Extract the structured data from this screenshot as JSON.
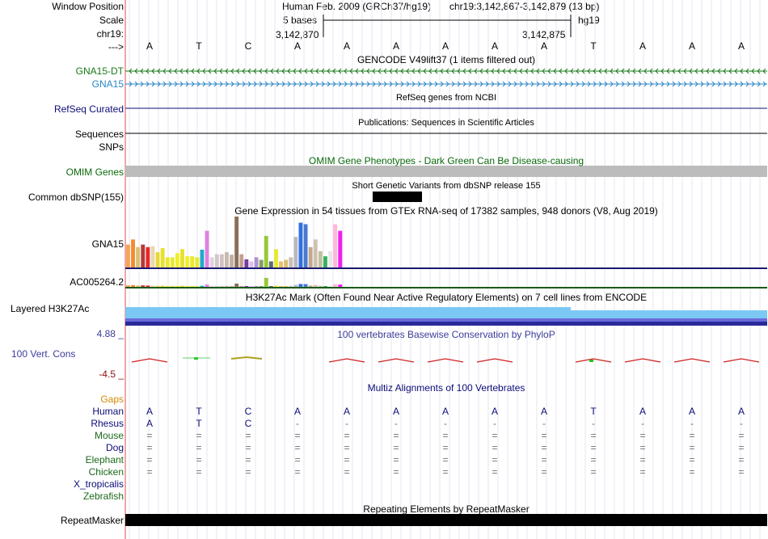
{
  "header": {
    "window_position_label": "Window Position",
    "scale_label": "Scale",
    "chr_label": "chr19:",
    "arrow_label": "--->",
    "assembly_text": "Human Feb. 2009 (GRCh37/hg19)",
    "position_text": "chr19:3,142,867-3,142,879 (13 bp)",
    "scale_text": "5 bases",
    "hg_label": "hg19",
    "coord_left": "3,142,870",
    "coord_right": "3,142,875"
  },
  "bases": [
    "A",
    "T",
    "C",
    "A",
    "A",
    "A",
    "A",
    "A",
    "A",
    "T",
    "A",
    "A",
    "A"
  ],
  "tracks": {
    "gencode": {
      "title": "GENCODE V49lift37 (1 items filtered out)",
      "item1": "GNA15-DT",
      "item2": "GNA15",
      "color1": "#1a7a1a",
      "color2": "#2a86c6"
    },
    "refseq": {
      "label": "RefSeq Curated",
      "title": "RefSeq genes from NCBI",
      "color": "#0c0c78"
    },
    "sequences": {
      "label": "Sequences",
      "title": "Publications: Sequences in Scientific Articles"
    },
    "snps": {
      "label": "SNPs"
    },
    "omim": {
      "label": "OMIM Genes",
      "title": "OMIM Gene Phenotypes - Dark Green Can Be Disease-causing",
      "color": "#0a6a0a"
    },
    "dbsnp": {
      "label": "Common dbSNP(155)",
      "title": "Short Genetic Variants from dbSNP release 155"
    },
    "gtex": {
      "title": "Gene Expression in 54 tissues from GTEx RNA-seq of 17382 samples, 948 donors (V8, Aug 2019)",
      "gene1": "GNA15",
      "gene2": "AC005264.2"
    },
    "h3k27ac": {
      "label": "Layered H3K27Ac",
      "title": "H3K27Ac Mark (Often Found Near Active Regulatory Elements) on 7 cell lines from ENCODE"
    },
    "cons": {
      "label": "100 Vert. Cons",
      "max": "4.88 _",
      "min": "-4.5 _",
      "title": "100 vertebrates Basewise Conservation by PhyloP",
      "color": "#3c3c9c"
    },
    "multiz": {
      "title": "Multiz Alignments of 100 Vertebrates",
      "gaps_label": "Gaps",
      "gaps_color": "#d08a00",
      "color": "#0c0c78"
    },
    "repeatmasker": {
      "label": "RepeatMasker",
      "title": "Repeating Elements by RepeatMasker"
    }
  },
  "species": [
    {
      "name": "Human",
      "color": "#0c0c78",
      "row": [
        "A",
        "T",
        "C",
        "A",
        "A",
        "A",
        "A",
        "A",
        "A",
        "T",
        "A",
        "A",
        "A"
      ]
    },
    {
      "name": "Rhesus",
      "color": "#0c0c78",
      "row": [
        "A",
        "T",
        "C",
        "-",
        "-",
        "-",
        "-",
        "-",
        "-",
        "-",
        "-",
        "-",
        "-"
      ]
    },
    {
      "name": "Mouse",
      "color": "#1a6a1a",
      "row": [
        "=",
        "=",
        "=",
        "=",
        "=",
        "=",
        "=",
        "=",
        "=",
        "=",
        "=",
        "=",
        "="
      ]
    },
    {
      "name": "Dog",
      "color": "#0c0c78",
      "row": [
        "=",
        "=",
        "=",
        "=",
        "=",
        "=",
        "=",
        "=",
        "=",
        "=",
        "=",
        "=",
        "="
      ]
    },
    {
      "name": "Elephant",
      "color": "#1a6a1a",
      "row": [
        "=",
        "=",
        "=",
        "=",
        "=",
        "=",
        "=",
        "=",
        "=",
        "=",
        "=",
        "=",
        "="
      ]
    },
    {
      "name": "Chicken",
      "color": "#1a6a1a",
      "row": [
        "=",
        "=",
        "=",
        "=",
        "=",
        "=",
        "=",
        "=",
        "=",
        "=",
        "=",
        "=",
        "="
      ]
    },
    {
      "name": "X_tropicalis",
      "color": "#0c0c78",
      "row": []
    },
    {
      "name": "Zebrafish",
      "color": "#1a6a1a",
      "row": []
    }
  ],
  "gtex_bars": [
    {
      "v": 0.45,
      "c": "#f6a35a"
    },
    {
      "v": 0.55,
      "c": "#f28c30"
    },
    {
      "v": 0.4,
      "c": "#d8c070"
    },
    {
      "v": 0.45,
      "c": "#b33a3a"
    },
    {
      "v": 0.4,
      "c": "#e82828"
    },
    {
      "v": 0.42,
      "c": "#e8d8b0"
    },
    {
      "v": 0.3,
      "c": "#e8d838"
    },
    {
      "v": 0.38,
      "c": "#e8e030"
    },
    {
      "v": 0.2,
      "c": "#e8e830"
    },
    {
      "v": 0.2,
      "c": "#e8e830"
    },
    {
      "v": 0.28,
      "c": "#f0f028"
    },
    {
      "v": 0.36,
      "c": "#e8e030"
    },
    {
      "v": 0.22,
      "c": "#f0f028"
    },
    {
      "v": 0.22,
      "c": "#e8e830"
    },
    {
      "v": 0.2,
      "c": "#e8e830"
    },
    {
      "v": 0.35,
      "c": "#22aacc"
    },
    {
      "v": 0.72,
      "c": "#e080e0"
    },
    {
      "v": 0.2,
      "c": "#e0d0e0"
    },
    {
      "v": 0.26,
      "c": "#d0c8c8"
    },
    {
      "v": 0.26,
      "c": "#d0c0c0"
    },
    {
      "v": 0.3,
      "c": "#c8b8b0"
    },
    {
      "v": 0.25,
      "c": "#c0b0a0"
    },
    {
      "v": 1.0,
      "c": "#8a7058"
    },
    {
      "v": 0.26,
      "c": "#c0a090"
    },
    {
      "v": 0.16,
      "c": "#7a3aa0"
    },
    {
      "v": 0.12,
      "c": "#d8c0f0"
    },
    {
      "v": 0.2,
      "c": "#b090d0"
    },
    {
      "v": 0.15,
      "c": "#80a060"
    },
    {
      "v": 0.62,
      "c": "#98c838"
    },
    {
      "v": 0.12,
      "c": "#5a6a70"
    },
    {
      "v": 0.36,
      "c": "#e8e830"
    },
    {
      "v": 0.12,
      "c": "#e8c068"
    },
    {
      "v": 0.15,
      "c": "#d8c070"
    },
    {
      "v": 0.2,
      "c": "#c8c0b8"
    },
    {
      "v": 0.6,
      "c": "#b8b8c0"
    },
    {
      "v": 0.88,
      "c": "#3070e0"
    },
    {
      "v": 0.85,
      "c": "#4a78d0"
    },
    {
      "v": 0.4,
      "c": "#c0a890"
    },
    {
      "v": 0.55,
      "c": "#d0c0b0"
    },
    {
      "v": 0.32,
      "c": "#c0c0a0"
    },
    {
      "v": 0.22,
      "c": "#38b060"
    },
    {
      "v": 0.32,
      "c": "#e8e8e8"
    },
    {
      "v": 0.85,
      "c": "#ffb8d8"
    },
    {
      "v": 0.72,
      "c": "#f020f0"
    }
  ]
}
